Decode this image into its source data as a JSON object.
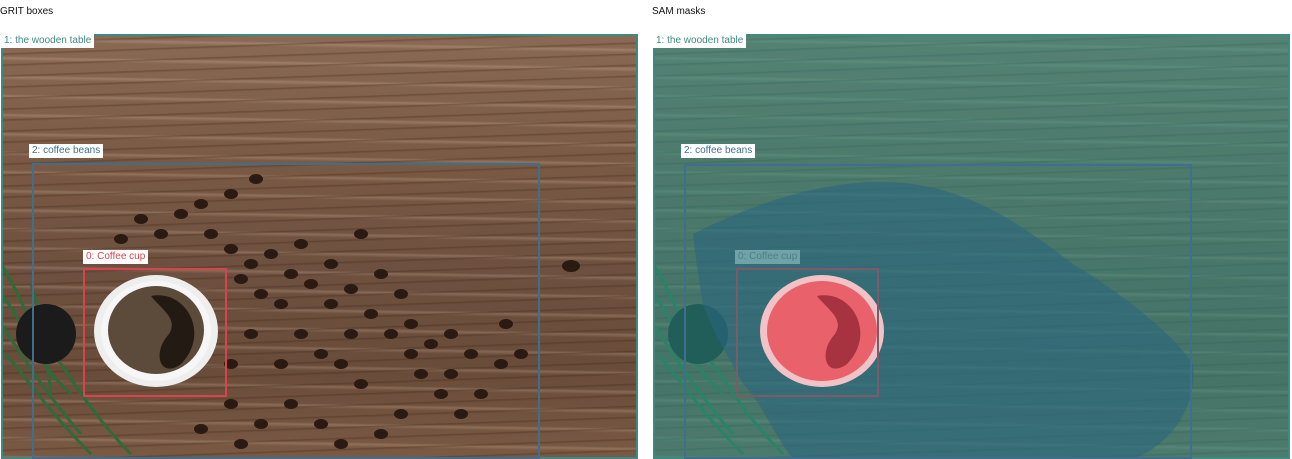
{
  "panels": {
    "left": {
      "title": "GRIT boxes"
    },
    "right": {
      "title": "SAM masks"
    }
  },
  "labels": {
    "table": "1: the wooden table",
    "beans": "2: coffee beans",
    "cup": "0: Coffee cup"
  },
  "colors": {
    "table": "#3e8a80",
    "beans": "#3f6f8c",
    "cup": "#d9434e",
    "table_mask": "rgba(40,150,140,0.55)",
    "beans_mask": "rgba(40,100,130,0.55)",
    "cup_mask": "rgba(230,80,90,0.6)"
  }
}
